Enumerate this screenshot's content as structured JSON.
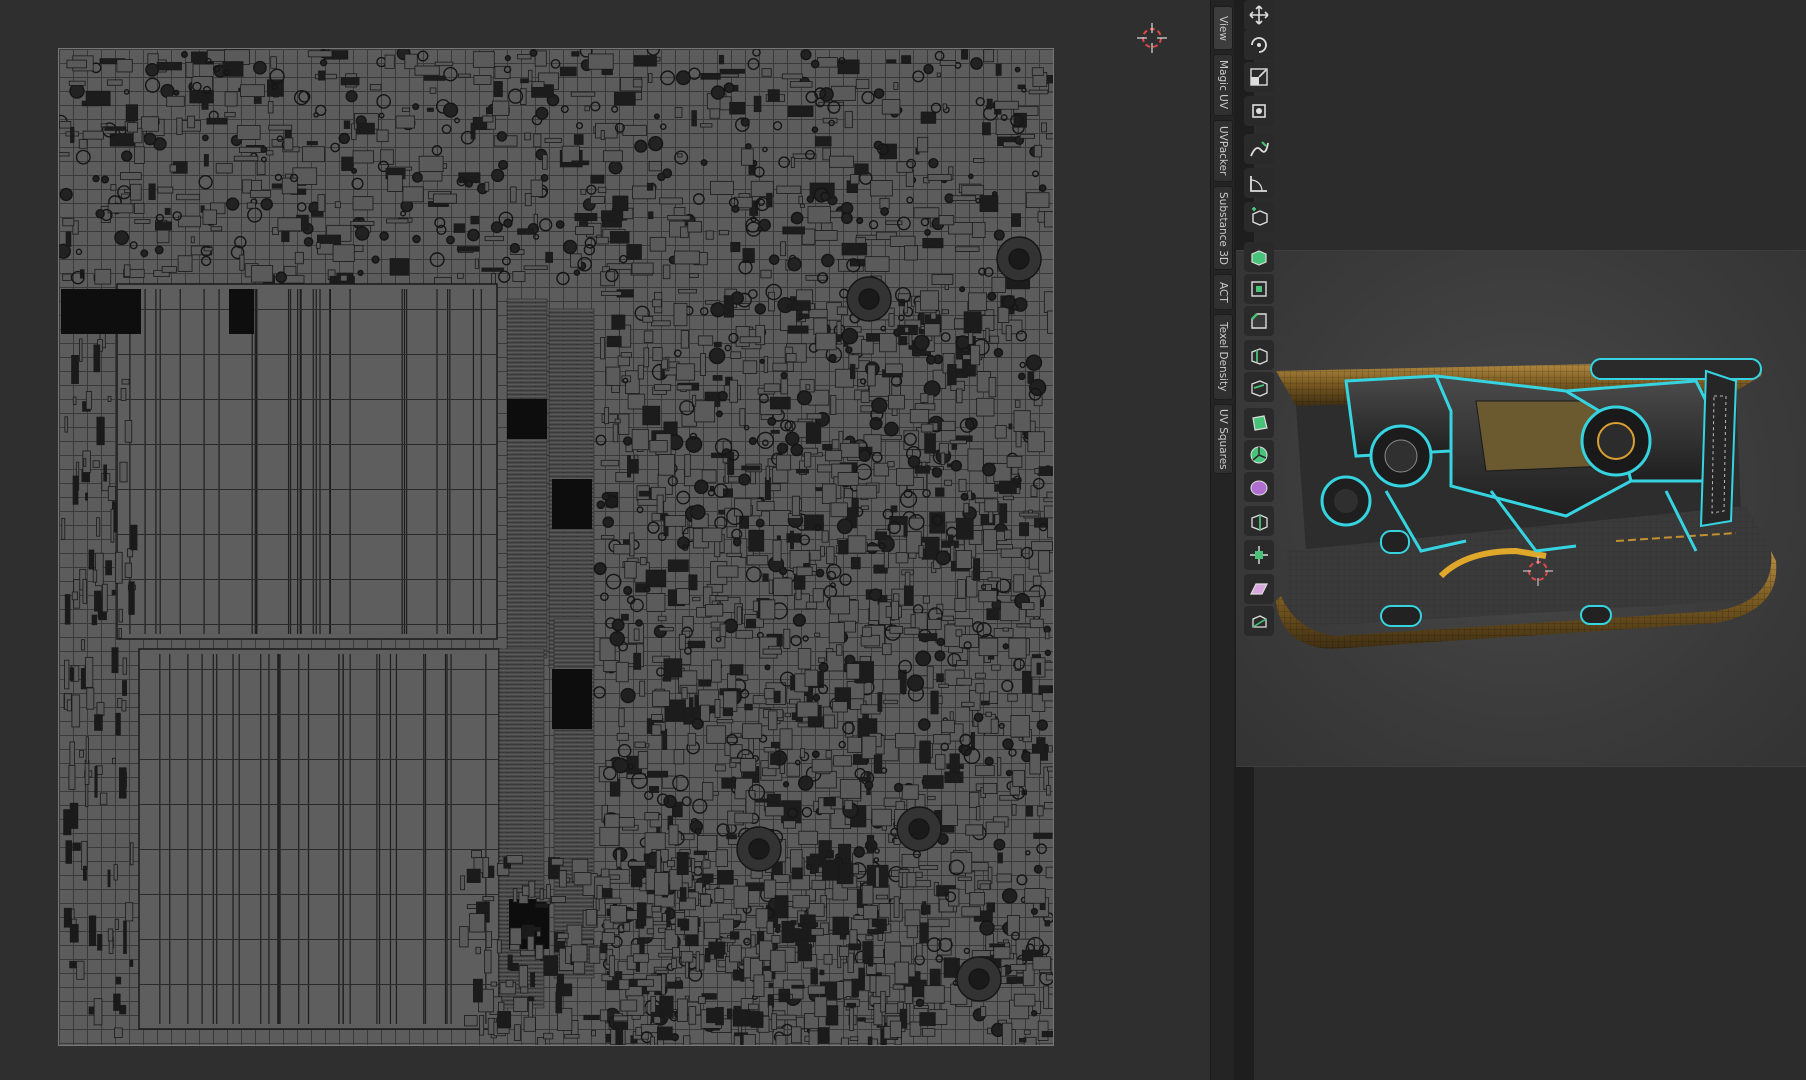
{
  "sidebar": {
    "tabs": [
      {
        "label": "View"
      },
      {
        "label": "Magic UV"
      },
      {
        "label": "UVPacker"
      },
      {
        "label": "Substance 3D"
      },
      {
        "label": "ACT"
      },
      {
        "label": "Texel Density"
      },
      {
        "label": "UV Squares"
      }
    ]
  },
  "toolbar": {
    "tools": [
      {
        "icon": "move-icon"
      },
      {
        "icon": "rotate-icon"
      },
      {
        "icon": "scale-icon"
      },
      {
        "icon": "transform-icon"
      },
      {
        "icon": "annotate-icon"
      },
      {
        "icon": "measure-icon"
      },
      {
        "icon": "add-cube-icon"
      },
      {
        "icon": "extrude-region-icon"
      },
      {
        "icon": "inset-faces-icon"
      },
      {
        "icon": "bevel-icon"
      },
      {
        "icon": "loop-cut-icon"
      },
      {
        "icon": "knife-icon"
      },
      {
        "icon": "poly-build-icon"
      },
      {
        "icon": "spin-icon"
      },
      {
        "icon": "smooth-icon"
      },
      {
        "icon": "edge-slide-icon"
      },
      {
        "icon": "shrink-fatten-icon"
      },
      {
        "icon": "shear-icon"
      },
      {
        "icon": "rip-region-icon"
      }
    ]
  },
  "colors": {
    "uv_background": "#5c5c5c",
    "uv_lines": "#1e1e1e",
    "wire_highlight": "#35d4e0",
    "rim_gold": "#8a6a2a"
  }
}
